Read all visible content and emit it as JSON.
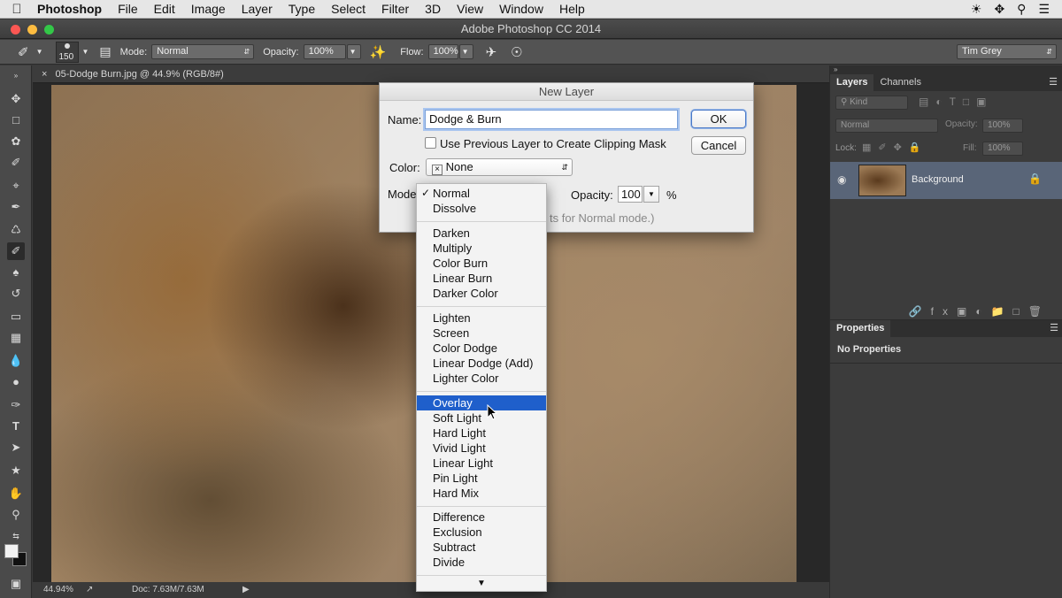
{
  "menubar": {
    "app": "Photoshop",
    "items": [
      "File",
      "Edit",
      "Image",
      "Layer",
      "Type",
      "Select",
      "Filter",
      "3D",
      "View",
      "Window",
      "Help"
    ]
  },
  "window": {
    "title": "Adobe Photoshop CC 2014"
  },
  "options": {
    "brush_size": "150",
    "mode_label": "Mode:",
    "mode_value": "Normal",
    "opacity_label": "Opacity:",
    "opacity_value": "100%",
    "flow_label": "Flow:",
    "flow_value": "100%",
    "workspace": "Tim Grey"
  },
  "document": {
    "tab_title": "05-Dodge Burn.jpg @ 44.9% (RGB/8#)",
    "zoom": "44.94%",
    "doc_info": "Doc: 7.63M/7.63M"
  },
  "layers_panel": {
    "tabs": [
      "Layers",
      "Channels"
    ],
    "kind": "Kind",
    "blend": "Normal",
    "opacity_label": "Opacity:",
    "opacity_value": "100%",
    "lock_label": "Lock:",
    "fill_label": "Fill:",
    "fill_value": "100%",
    "layer_name": "Background"
  },
  "properties_panel": {
    "tab": "Properties",
    "message": "No Properties"
  },
  "dialog": {
    "title": "New Layer",
    "name_label": "Name:",
    "name_value": "Dodge & Burn",
    "clip_label": "Use Previous Layer to Create Clipping Mask",
    "color_label": "Color:",
    "color_value": "None",
    "mode_label": "Mode",
    "opacity_label": "Opacity:",
    "opacity_value": "100",
    "percent": "%",
    "hint": "ts for Normal mode.)",
    "ok": "OK",
    "cancel": "Cancel"
  },
  "mode_menu": {
    "items": [
      "Normal",
      "Dissolve",
      "Darken",
      "Multiply",
      "Color Burn",
      "Linear Burn",
      "Darker Color",
      "Lighten",
      "Screen",
      "Color Dodge",
      "Linear Dodge (Add)",
      "Lighter Color",
      "Overlay",
      "Soft Light",
      "Hard Light",
      "Vivid Light",
      "Linear Light",
      "Pin Light",
      "Hard Mix",
      "Difference",
      "Exclusion",
      "Subtract",
      "Divide"
    ],
    "checked": "Normal",
    "highlighted": "Overlay"
  }
}
